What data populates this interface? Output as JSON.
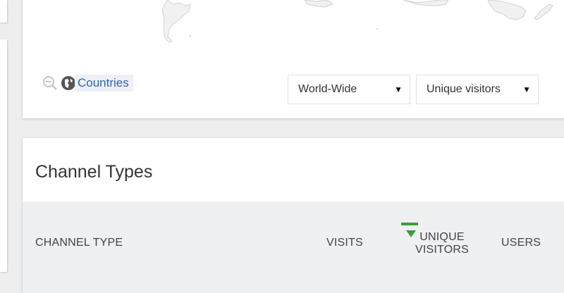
{
  "map": {
    "countries_link": "Countries",
    "region_select": "World-Wide",
    "metric_select": "Unique visitors"
  },
  "channel_types": {
    "title": "Channel Types",
    "columns": [
      "CHANNEL TYPE",
      "VISITS",
      "UNIQUE VISITORS",
      "USERS"
    ],
    "sorted_column": "UNIQUE VISITORS",
    "sort_direction": "descending",
    "sort_color": "#3a9f3a"
  },
  "icons": {
    "zoom_out": "zoom-out-icon",
    "globe": "globe-icon",
    "caret": "caret-down-icon"
  }
}
